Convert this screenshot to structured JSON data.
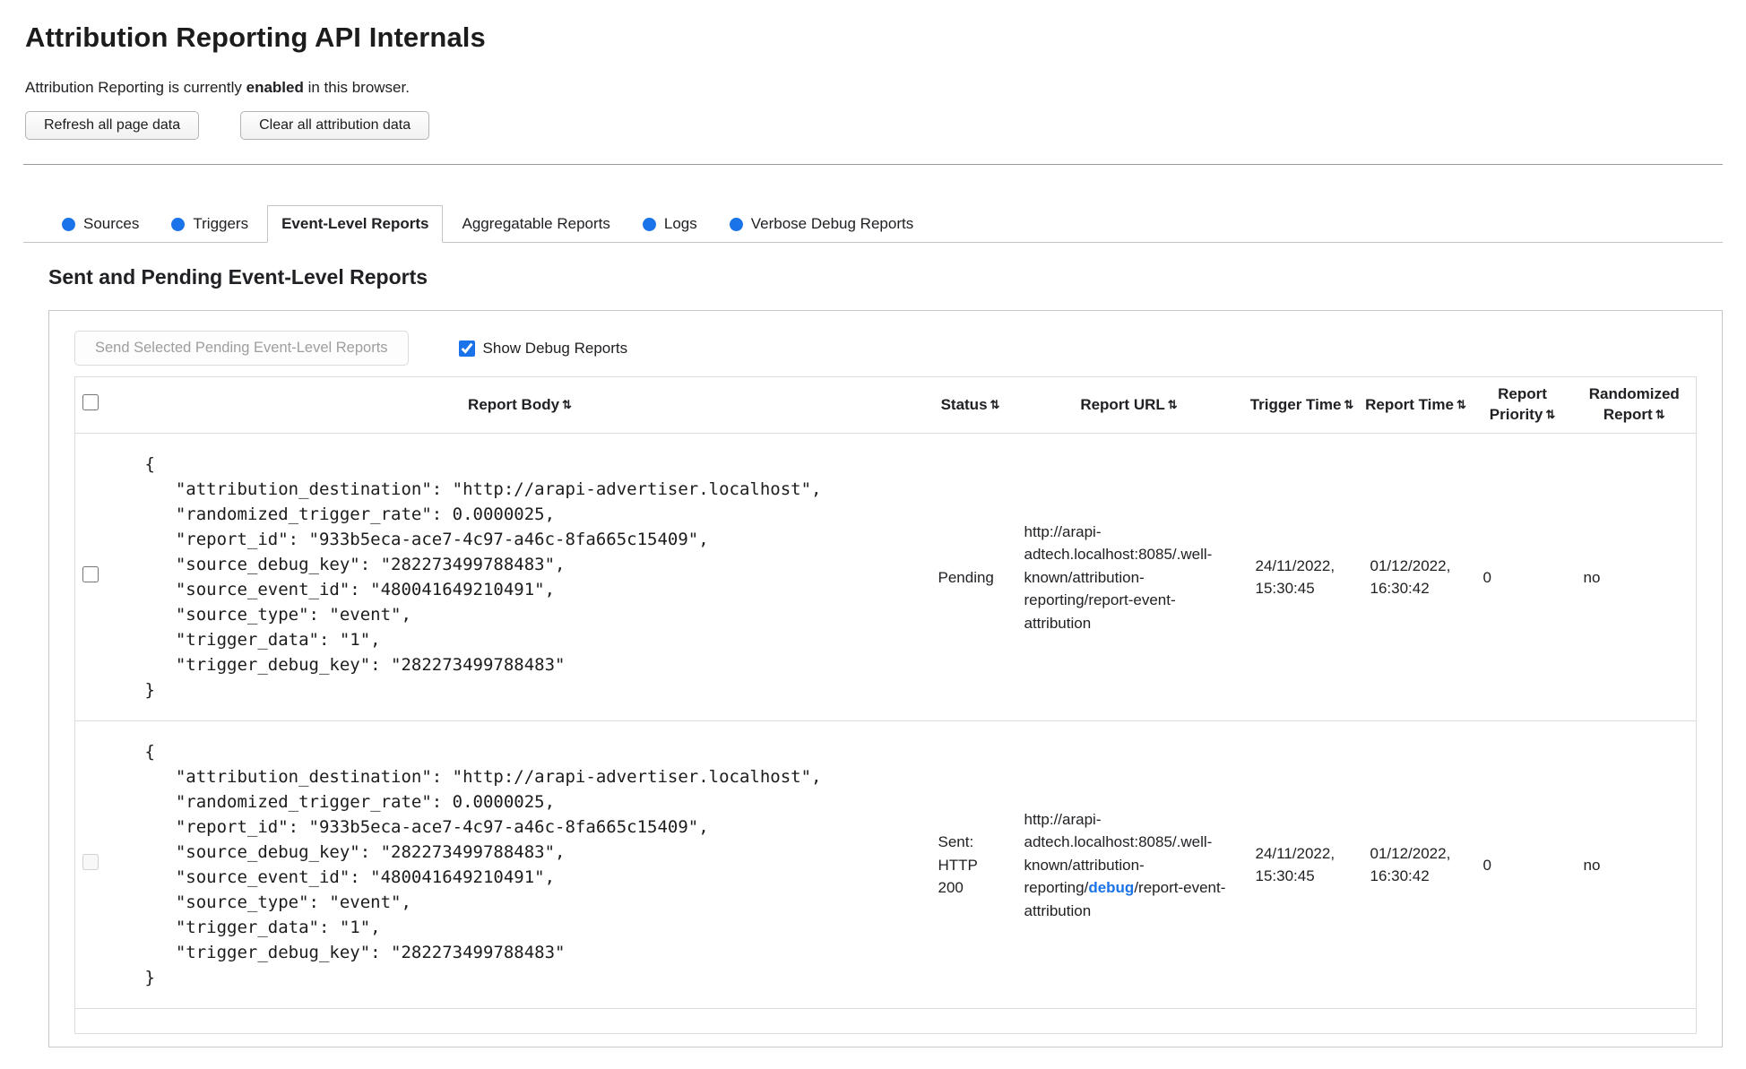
{
  "icons": {
    "sort": "⇅"
  },
  "page": {
    "title": "Attribution Reporting API Internals",
    "status": {
      "prefix": "Attribution Reporting is currently ",
      "emphasis": "enabled",
      "suffix": " in this browser."
    },
    "buttons": {
      "refresh": "Refresh all page data",
      "clear": "Clear all attribution data"
    }
  },
  "tabs": [
    {
      "label": "Sources"
    },
    {
      "label": "Triggers"
    },
    {
      "label": "Event-Level Reports"
    },
    {
      "label": "Aggregatable Reports"
    },
    {
      "label": "Logs"
    },
    {
      "label": "Verbose Debug Reports"
    }
  ],
  "panel": {
    "heading": "Sent and Pending Event-Level Reports",
    "send_button": "Send Selected Pending Event-Level Reports",
    "show_debug_label": "Show Debug Reports"
  },
  "table": {
    "headers": {
      "report_body": "Report Body",
      "status": "Status",
      "report_url": "Report URL",
      "trigger_time": "Trigger Time",
      "report_time": "Report Time",
      "report_priority": "Report Priority",
      "randomized_report": "Randomized Report"
    },
    "rows": [
      {
        "body": "{\n   \"attribution_destination\": \"http://arapi-advertiser.localhost\",\n   \"randomized_trigger_rate\": 0.0000025,\n   \"report_id\": \"933b5eca-ace7-4c97-a46c-8fa665c15409\",\n   \"source_debug_key\": \"282273499788483\",\n   \"source_event_id\": \"480041649210491\",\n   \"source_type\": \"event\",\n   \"trigger_data\": \"1\",\n   \"trigger_debug_key\": \"282273499788483\"\n}",
        "status": "Pending",
        "url": "http://arapi-adtech.localhost:8085/.well-known/attribution-reporting/report-event-attribution",
        "trigger_time": "24/11/2022, 15:30:45",
        "report_time": "01/12/2022, 16:30:42",
        "priority": "0",
        "randomized": "no"
      },
      {
        "body": "{\n   \"attribution_destination\": \"http://arapi-advertiser.localhost\",\n   \"randomized_trigger_rate\": 0.0000025,\n   \"report_id\": \"933b5eca-ace7-4c97-a46c-8fa665c15409\",\n   \"source_debug_key\": \"282273499788483\",\n   \"source_event_id\": \"480041649210491\",\n   \"source_type\": \"event\",\n   \"trigger_data\": \"1\",\n   \"trigger_debug_key\": \"282273499788483\"\n}",
        "status": "Sent: HTTP 200",
        "url_prefix": "http://arapi-adtech.localhost:8085/.well-known/attribution-reporting/",
        "url_link": "debug",
        "url_suffix": "/report-event-attribution",
        "trigger_time": "24/11/2022, 15:30:45",
        "report_time": "01/12/2022, 16:30:42",
        "priority": "0",
        "randomized": "no"
      }
    ]
  }
}
